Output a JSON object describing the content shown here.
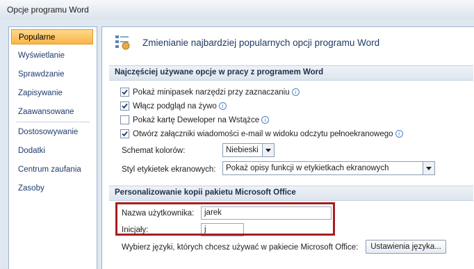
{
  "window": {
    "title": "Opcje programu Word"
  },
  "sidebar": {
    "items": [
      {
        "label": "Popularne",
        "active": true
      },
      {
        "label": "Wyświetlanie"
      },
      {
        "label": "Sprawdzanie"
      },
      {
        "label": "Zapisywanie"
      },
      {
        "label": "Zaawansowane"
      },
      {
        "label": "Dostosowywanie"
      },
      {
        "label": "Dodatki"
      },
      {
        "label": "Centrum zaufania"
      },
      {
        "label": "Zasoby"
      }
    ]
  },
  "header": {
    "title": "Zmienianie najbardziej popularnych opcji programu Word"
  },
  "section1": {
    "title": "Najczęściej używane opcje w pracy z programem Word",
    "checkboxes": [
      {
        "label": "Pokaż minipasek narzędzi przy zaznaczaniu",
        "checked": true
      },
      {
        "label": "Włącz podgląd na żywo",
        "checked": true
      },
      {
        "label": "Pokaż kartę Deweloper na Wstążce",
        "checked": false
      },
      {
        "label": "Otwórz załączniki wiadomości e-mail w widoku odczytu pełnoekranowego",
        "checked": true
      }
    ],
    "color_scheme_label": "Schemat kolorów:",
    "color_scheme_value": "Niebieski",
    "tooltip_style_label": "Styl etykietek ekranowych:",
    "tooltip_style_value": "Pokaż opisy funkcji w etykietkach ekranowych"
  },
  "section2": {
    "title": "Personalizowanie kopii pakietu Microsoft Office",
    "username_label": "Nazwa użytkownika:",
    "username_value": "jarek",
    "initials_label": "Inicjały:",
    "initials_value": "j",
    "languages_text": "Wybierz języki, których chcesz używać w pakiecie Microsoft Office:",
    "language_button": "Ustawienia języka..."
  },
  "colors": {
    "highlight": "#a81d1d",
    "active_item": "#fbb449"
  }
}
